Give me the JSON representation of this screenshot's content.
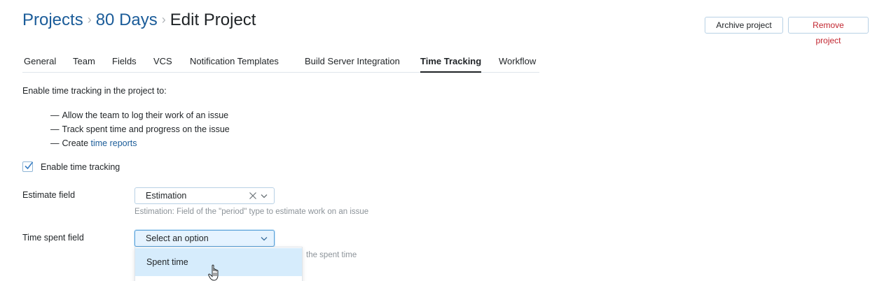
{
  "breadcrumb": {
    "projects": "Projects",
    "project_name": "80 Days",
    "current": "Edit Project",
    "separator": "›"
  },
  "actions": {
    "archive_label": "Archive project",
    "remove_label": "Remove project"
  },
  "tabs": [
    {
      "label": "General"
    },
    {
      "label": "Team"
    },
    {
      "label": "Fields"
    },
    {
      "label": "VCS"
    },
    {
      "label": "Notification Templates"
    },
    {
      "label": "Build Server Integration"
    },
    {
      "label": "Time Tracking",
      "active": true
    },
    {
      "label": "Workflow"
    }
  ],
  "intro": "Enable time tracking in the project to:",
  "bullets": {
    "dash": "—",
    "item1": "Allow the team to log their work of an issue",
    "item2": "Track spent time and progress on the issue",
    "item3_prefix": "Create ",
    "item3_link": "time reports"
  },
  "enable_tracking": {
    "label": "Enable time tracking",
    "checked": true
  },
  "estimate_field": {
    "label": "Estimate field",
    "value": "Estimation",
    "hint": "Estimation: Field of the \"period\" type to estimate work on an issue"
  },
  "time_spent_field": {
    "label": "Time spent field",
    "placeholder": "Select an option",
    "hint_visible": "the spent time"
  },
  "dropdown": {
    "options": [
      "Spent time"
    ]
  },
  "colors": {
    "link": "#1b5c99",
    "danger": "#c22731",
    "highlight": "#d6ecfc",
    "border": "#b8d1e5"
  }
}
